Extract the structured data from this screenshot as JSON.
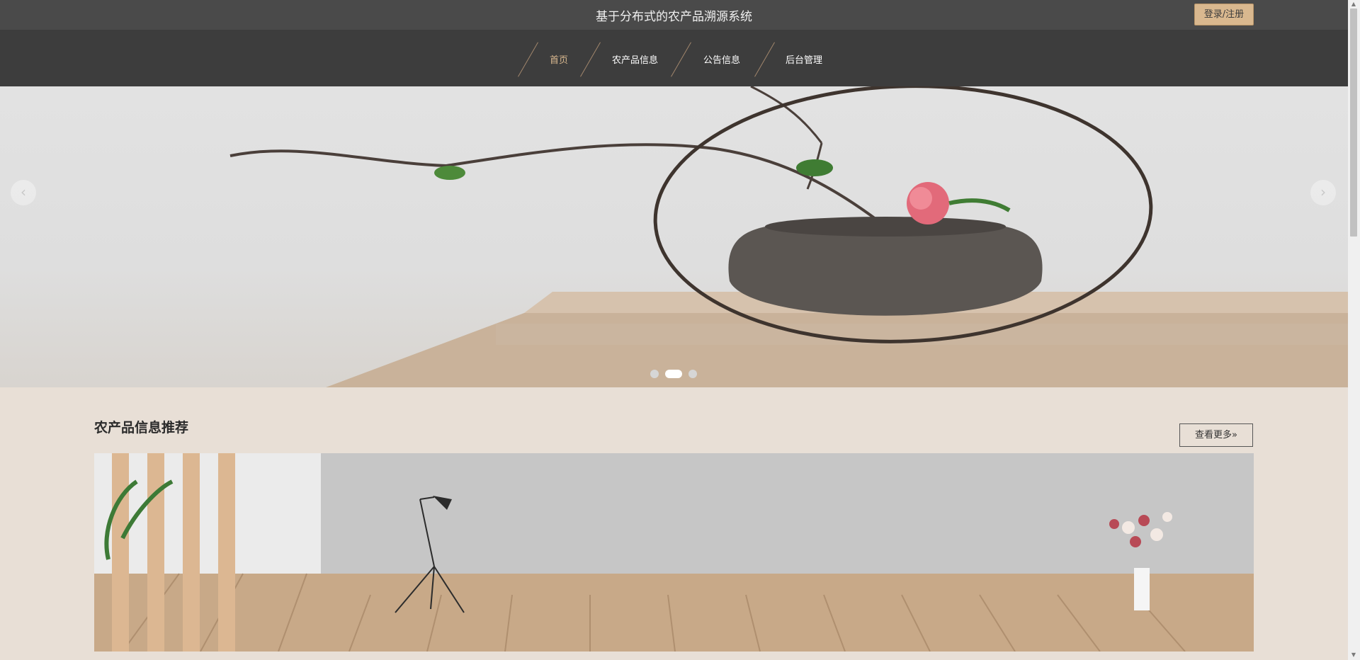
{
  "header": {
    "site_title": "基于分布式的农产品溯源系统",
    "login_label": "登录/注册"
  },
  "nav": {
    "items": [
      {
        "label": "首页",
        "active": true
      },
      {
        "label": "农产品信息",
        "active": false
      },
      {
        "label": "公告信息",
        "active": false
      },
      {
        "label": "后台管理",
        "active": false
      }
    ]
  },
  "carousel": {
    "prev_icon": "‹",
    "next_icon": "›",
    "slide_count": 3,
    "active_slide": 2
  },
  "section": {
    "title": "农产品信息推荐",
    "more_label": "查看更多»"
  },
  "colors": {
    "accent": "#d9b88f",
    "topbar": "#4a4a4a",
    "navbar": "#3d3d3d",
    "page_bg": "#e8dfd6"
  }
}
